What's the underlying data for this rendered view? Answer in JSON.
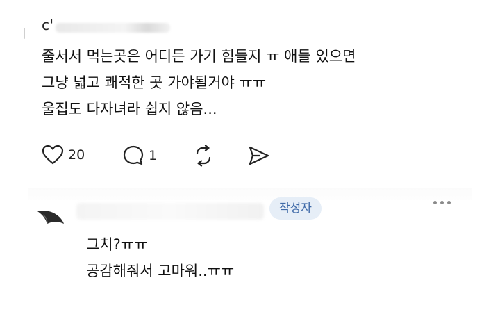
{
  "post": {
    "username": "c'",
    "lines": [
      "줄서서 먹는곳은 어디든 가기 힘들지 ㅠ  애들 있으면",
      "그냥 넓고 쾌적한 곳 가야될거야 ㅠㅠ",
      " 울집도 다자녀라 쉽지 않음..."
    ],
    "actions": {
      "like_count": "20",
      "comment_count": "1"
    }
  },
  "reply": {
    "badge": "작성자",
    "lines": [
      "그치?ㅠㅠ",
      "공감해줘서 고마워..ㅠㅠ"
    ]
  }
}
